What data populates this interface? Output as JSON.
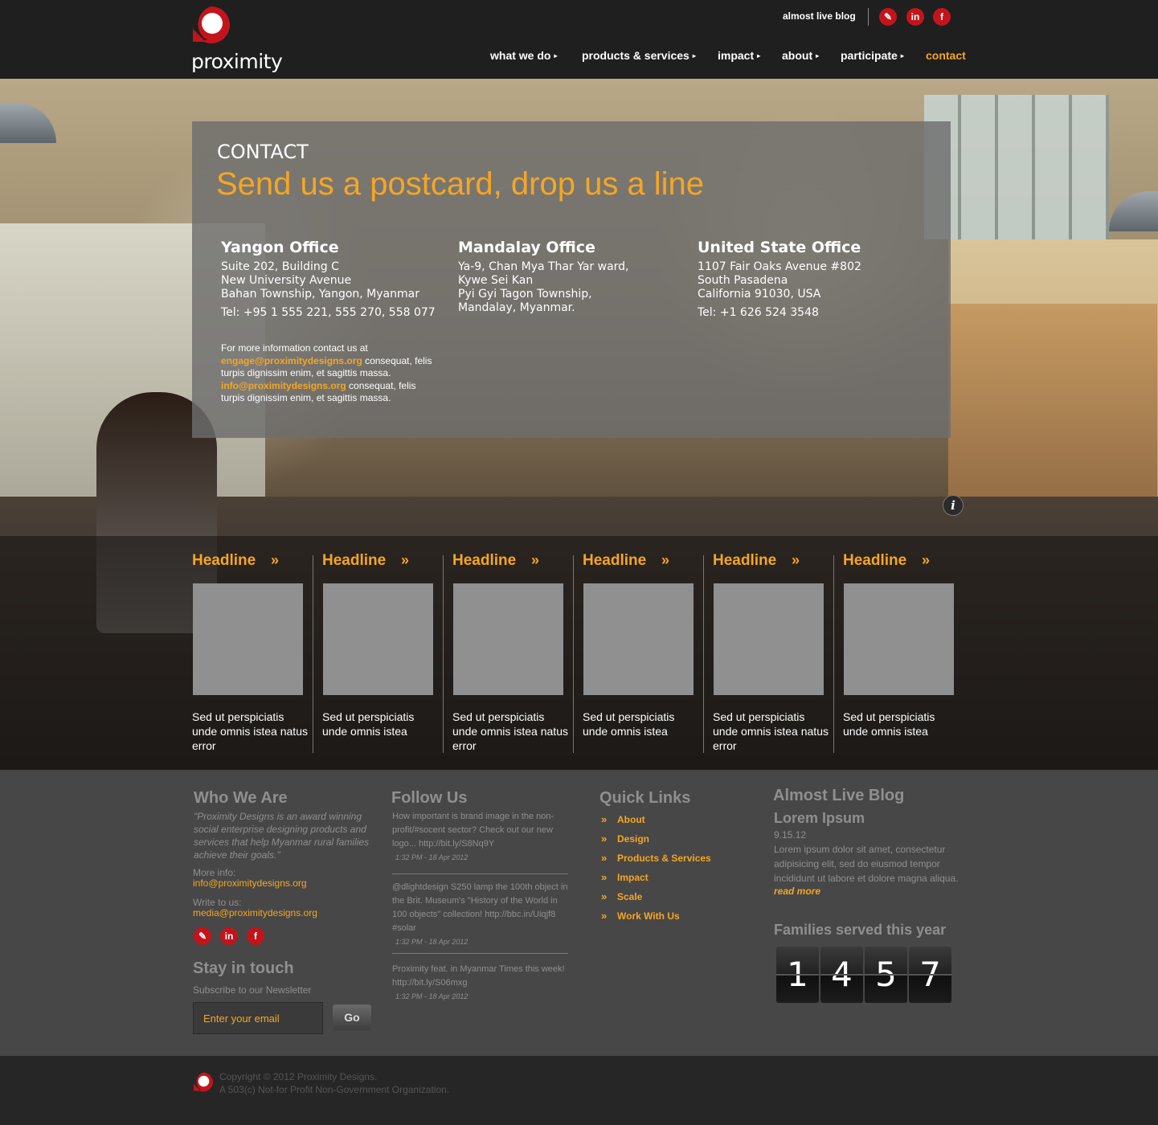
{
  "header": {
    "brand": "proximity",
    "blog_link": "almost live blog",
    "social": [
      "twitter-icon",
      "linkedin-icon",
      "facebook-icon"
    ],
    "nav": [
      {
        "label": "what we do",
        "dropdown": true
      },
      {
        "label": "products & services",
        "dropdown": true
      },
      {
        "label": "impact",
        "dropdown": true
      },
      {
        "label": "about",
        "dropdown": true
      },
      {
        "label": "participate",
        "dropdown": true
      },
      {
        "label": "contact",
        "dropdown": false,
        "active": true
      }
    ]
  },
  "contact": {
    "kicker": "CONTACT",
    "title": "Send us a postcard, drop us a line",
    "offices": [
      {
        "name": "Yangon Office",
        "lines": [
          "Suite 202, Building C",
          "New University Avenue",
          "Bahan Township, Yangon, Myanmar"
        ],
        "tel": "Tel: +95 1 555 221, 555 270, 558 077"
      },
      {
        "name": "Mandalay Office",
        "lines": [
          "Ya-9, Chan Mya Thar Yar ward,",
          "Kywe Sei Kan",
          "Pyi Gyi Tagon Township,",
          "Mandalay, Myanmar."
        ],
        "tel": ""
      },
      {
        "name": "United State Office",
        "lines": [
          "1107 Fair Oaks Avenue #802",
          "South Pasadena",
          "California 91030, USA"
        ],
        "tel": "Tel: +1 626 524 3548"
      }
    ],
    "more_intro": "For more information contact us at",
    "email1": "engage@proximitydesigns.org",
    "email1_after": " consequat, felis turpis dignissim enim, et sagittis massa.",
    "email2": "info@proximitydesigns.org",
    "email2_after": " consequat, felis turpis dignissim enim, et sagittis massa."
  },
  "headlines": [
    {
      "title": "Headline",
      "text": "Sed ut perspiciatis unde omnis istea natus error"
    },
    {
      "title": "Headline",
      "text": "Sed ut perspiciatis unde omnis istea"
    },
    {
      "title": "Headline",
      "text": "Sed ut perspiciatis unde omnis istea natus error"
    },
    {
      "title": "Headline",
      "text": "Sed ut perspiciatis unde omnis istea"
    },
    {
      "title": "Headline",
      "text": "Sed ut perspiciatis unde omnis istea natus error"
    },
    {
      "title": "Headline",
      "text": "Sed ut perspiciatis unde omnis istea"
    }
  ],
  "footer": {
    "who": {
      "heading": "Who We Are",
      "quote": "\"Proximity Designs is an award winning social enterprise designing products and services that help Myanmar rural families achieve their goals.\"",
      "more_label": "More info:",
      "more_email": "info@proximitydesigns.org",
      "write_label": "Write to us:",
      "write_email": "media@proximitydesigns.org"
    },
    "stay": {
      "heading": "Stay in touch",
      "sub": "Subscribe to our Newsletter",
      "placeholder": "Enter your email",
      "go": "Go"
    },
    "follow": {
      "heading": "Follow Us",
      "tweets": [
        {
          "text": "How important is brand image in the non-profit/#socent sector? Check out our new logo... http://bit.ly/S8Nq9Y",
          "time": "1:32 PM - 18 Apr 2012"
        },
        {
          "text": "@dlightdesign S250 lamp the 100th object in the Brit. Museum's \"History of the World in 100 objects\" collection! http://bbc.in/Uiqjf8 #solar",
          "time": "1:32 PM - 18 Apr 2012"
        },
        {
          "text": "Proximity feat. in Myanmar Times this week! http://bit.ly/S06mxg",
          "time": "1:32 PM - 18 Apr 2012"
        }
      ]
    },
    "quick": {
      "heading": "Quick Links",
      "links": [
        "About",
        "Design",
        "Products & Services",
        "Impact",
        "Scale",
        "Work With Us"
      ]
    },
    "blog": {
      "heading": "Almost Live Blog",
      "post_title": "Lorem Ipsum",
      "date": "9.15.12",
      "excerpt": "Lorem ipsum dolor sit amet, consectetur adipisicing elit, sed do eiusmod tempor incididunt ut labore et dolore magna aliqua.",
      "read_more": "read more",
      "families_label": "Families served this year",
      "families_digits": [
        "1",
        "4",
        "5",
        "7"
      ]
    },
    "copyright1": "Copyright © 2012 Proximity Designs.",
    "copyright2": "A 503(c) Not-for Profit Non-Government Organization."
  },
  "colors": {
    "accent": "#f5a623",
    "brand_red": "#c3141b"
  }
}
